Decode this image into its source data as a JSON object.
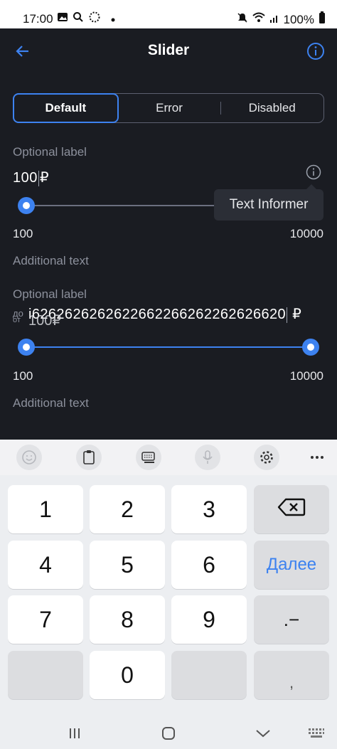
{
  "status_bar": {
    "time": "17:00",
    "battery": "100%"
  },
  "app_bar": {
    "title": "Slider"
  },
  "segmented": {
    "items": [
      "Default",
      "Error",
      "Disabled"
    ],
    "selected": "Default"
  },
  "slider_single": {
    "label": "Optional label",
    "value_text": "100",
    "currency": "₽",
    "min_label": "100",
    "max_label": "10000",
    "additional_text": "Additional text",
    "tooltip": "Text Informer",
    "fraction": 0.0
  },
  "slider_range": {
    "label": "Optional label",
    "overlay_text": "до",
    "overlay_text_small": "от",
    "value_text": "i6262626262622662266262262626620",
    "currency": "₽",
    "under_value": "100",
    "under_currency": "₽",
    "min_label": "100",
    "max_label": "10000",
    "additional_text": "Additional text",
    "start_fraction": 0.0,
    "end_fraction": 1.0
  },
  "keyboard": {
    "rows": [
      [
        "1",
        "2",
        "3",
        "⌫"
      ],
      [
        "4",
        "5",
        "6",
        "Далее"
      ],
      [
        "7",
        "8",
        "9",
        ".−"
      ],
      [
        "",
        "0",
        "",
        ","
      ]
    ]
  },
  "colors": {
    "accent": "#3d82f0",
    "background": "#1a1c22",
    "tooltip_bg": "#2b2e36"
  }
}
